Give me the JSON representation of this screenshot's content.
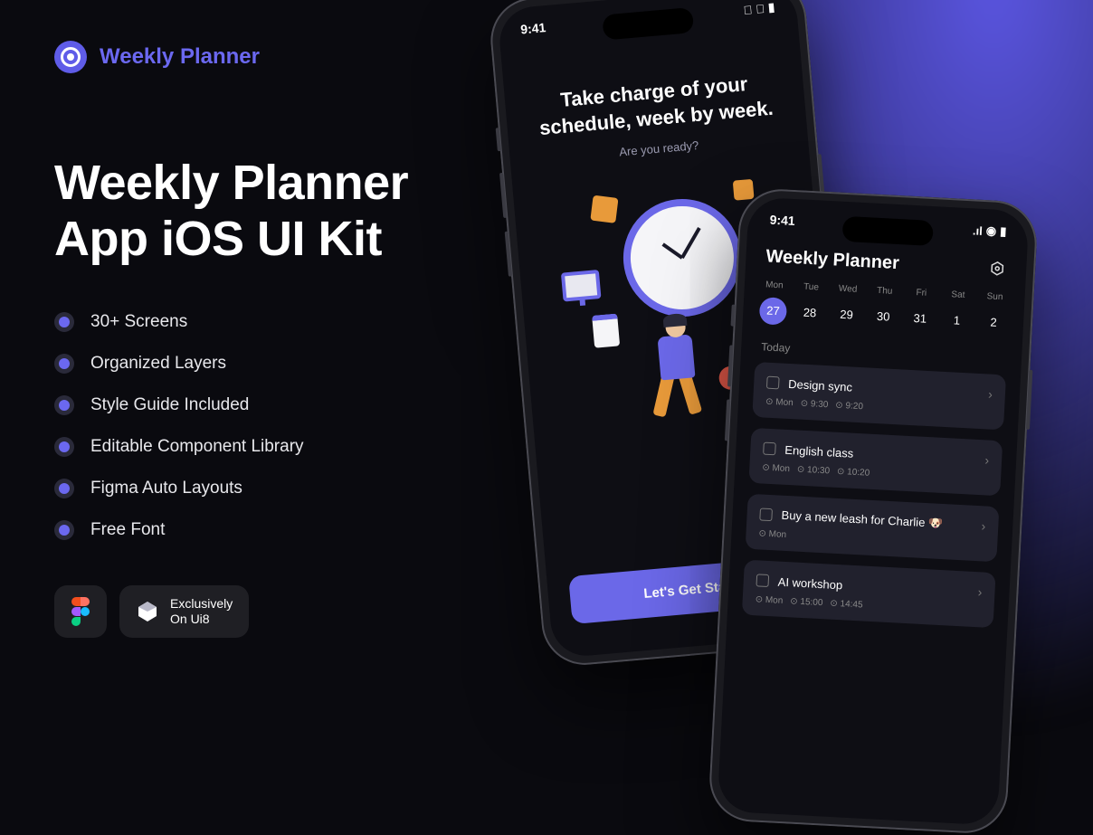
{
  "brand": {
    "name": "Weekly Planner"
  },
  "headline": "Weekly Planner\nApp iOS UI Kit",
  "features": [
    "30+ Screens",
    "Organized Layers",
    "Style Guide Included",
    "Editable Component Library",
    "Figma Auto Layouts",
    "Free Font"
  ],
  "badges": {
    "ui8_line1": "Exclusively",
    "ui8_line2": "On Ui8"
  },
  "phone_onboarding": {
    "status_time": "9:41",
    "title": "Take charge of your schedule, week by week.",
    "subtitle": "Are you ready?",
    "cta": "Let's Get Started"
  },
  "phone_planner": {
    "status_time": "9:41",
    "title": "Weekly Planner",
    "days": [
      {
        "label": "Mon",
        "num": "27",
        "selected": true
      },
      {
        "label": "Tue",
        "num": "28",
        "selected": false
      },
      {
        "label": "Wed",
        "num": "29",
        "selected": false
      },
      {
        "label": "Thu",
        "num": "30",
        "selected": false
      },
      {
        "label": "Fri",
        "num": "31",
        "selected": false
      },
      {
        "label": "Sat",
        "num": "1",
        "selected": false
      },
      {
        "label": "Sun",
        "num": "2",
        "selected": false
      }
    ],
    "section": "Today",
    "tasks": [
      {
        "title": "Design sync",
        "day": "Mon",
        "start": "9:30",
        "end": "9:20"
      },
      {
        "title": "English class",
        "day": "Mon",
        "start": "10:30",
        "end": "10:20"
      },
      {
        "title": "Buy a new leash for Charlie 🐶",
        "day": "Mon",
        "start": "",
        "end": ""
      },
      {
        "title": "AI workshop",
        "day": "Mon",
        "start": "15:00",
        "end": "14:45"
      }
    ]
  }
}
